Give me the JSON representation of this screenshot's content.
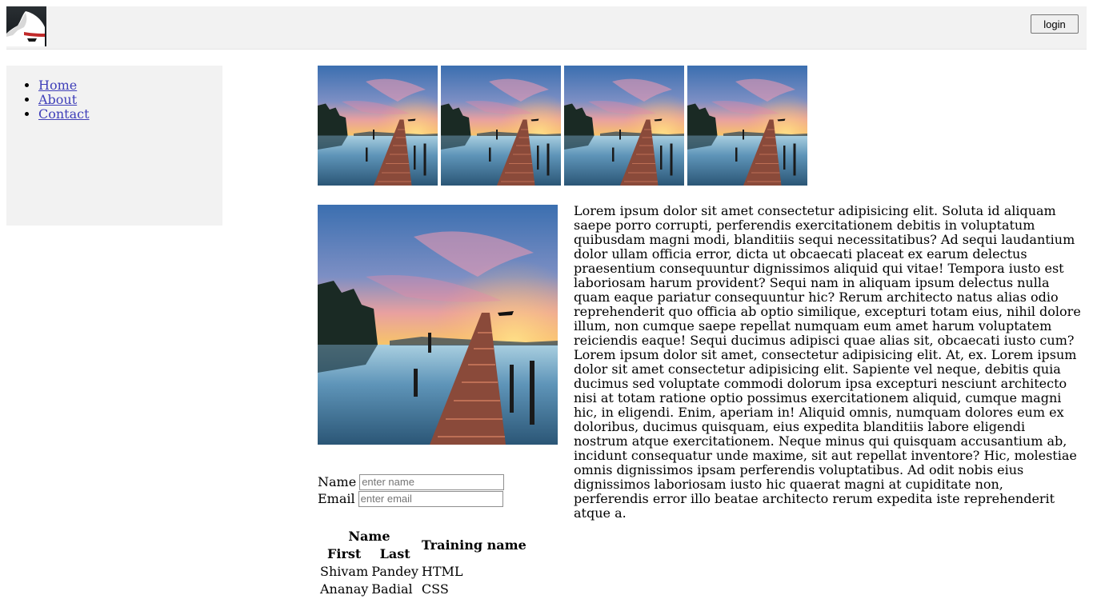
{
  "header": {
    "logo_icon": "mask-icon",
    "login_label": "login"
  },
  "sidebar": {
    "items": [
      {
        "label": "Home"
      },
      {
        "label": "About"
      },
      {
        "label": "Contact"
      }
    ]
  },
  "gallery": {
    "thumbnail_count": 4,
    "image_subject": "sunset-pier-landscape"
  },
  "content": {
    "paragraph": "Lorem ipsum dolor sit amet consectetur adipisicing elit. Soluta id aliquam saepe porro corrupti, perferendis exercitationem debitis in voluptatum quibusdam magni modi, blanditiis sequi necessitatibus? Ad sequi laudantium dolor ullam officia error, dicta ut obcaecati placeat ex earum delectus praesentium consequuntur dignissimos aliquid qui vitae! Tempora iusto est laboriosam harum provident? Sequi nam in aliquam ipsum delectus nulla quam eaque pariatur consequuntur hic? Rerum architecto natus alias odio reprehenderit quo officia ab optio similique, excepturi totam eius, nihil dolore illum, non cumque saepe repellat numquam eum amet harum voluptatem reiciendis eaque! Sequi ducimus adipisci quae alias sit, obcaecati iusto cum?Lorem ipsum dolor sit amet, consectetur adipisicing elit. At, ex. Lorem ipsum dolor sit amet consectetur adipisicing elit. Sapiente vel neque, debitis quia ducimus sed voluptate commodi dolorum ipsa excepturi nesciunt architecto nisi at totam ratione optio possimus exercitationem aliquid, cumque magni hic, in eligendi. Enim, aperiam in! Aliquid omnis, numquam dolores eum ex doloribus, ducimus quisquam, eius expedita blanditiis labore eligendi nostrum atque exercitationem. Neque minus qui quisquam accusantium ab, incidunt consequatur unde maxime, sit aut repellat inventore? Hic, molestiae omnis dignissimos ipsam perferendis voluptatibus. Ad odit nobis eius dignissimos laboriosam iusto hic quaerat magni at cupiditate non, perferendis error illo beatae architecto rerum expedita iste reprehenderit atque a."
  },
  "form": {
    "name_label": "Name",
    "name_placeholder": "enter name",
    "name_value": "",
    "email_label": "Email",
    "email_placeholder": "enter email",
    "email_value": ""
  },
  "table": {
    "header_group": "Name",
    "header_first": "First",
    "header_last": "Last",
    "header_training": "Training name",
    "rows": [
      {
        "first": "Shivam",
        "last": "Pandey",
        "training": "HTML"
      },
      {
        "first": "Ananay",
        "last": "Badial",
        "training": "CSS"
      }
    ]
  }
}
